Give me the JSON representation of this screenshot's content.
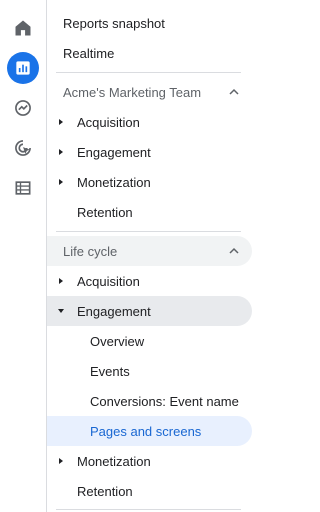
{
  "rail": {
    "items": [
      {
        "icon": "home-icon",
        "active": false
      },
      {
        "icon": "reports-icon",
        "active": true
      },
      {
        "icon": "explore-icon",
        "active": false
      },
      {
        "icon": "advertising-icon",
        "active": false
      },
      {
        "icon": "configure-icon",
        "active": false
      }
    ]
  },
  "nav": {
    "top_items": [
      "Reports snapshot",
      "Realtime"
    ],
    "collection1": {
      "title": "Acme's Marketing Team",
      "items": [
        "Acquisition",
        "Engagement",
        "Monetization",
        "Retention"
      ]
    },
    "collection2": {
      "title": "Life cycle",
      "items": {
        "acquisition": "Acquisition",
        "engagement": "Engagement",
        "engagement_children": [
          "Overview",
          "Events",
          "Conversions: Event name",
          "Pages and screens"
        ],
        "monetization": "Monetization",
        "retention": "Retention"
      }
    }
  },
  "colors": {
    "accent": "#1a73e8",
    "selected_bg": "#e8f0fe",
    "selected_text": "#1967d2",
    "expanded_bg": "#e8eaed"
  }
}
